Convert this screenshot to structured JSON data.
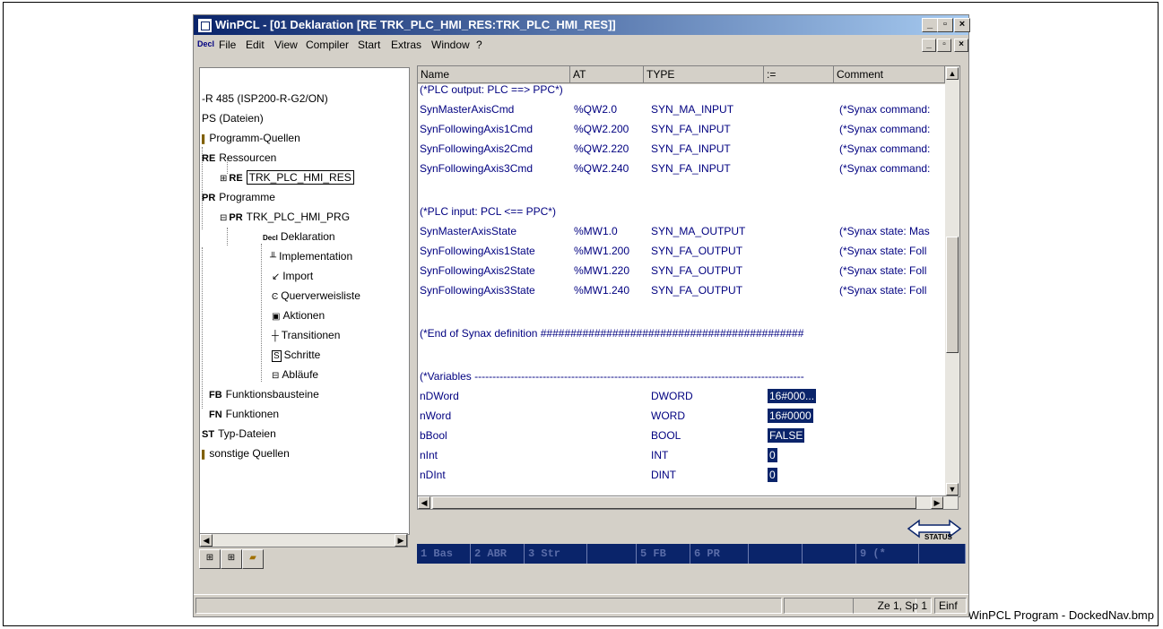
{
  "window": {
    "title": "WinPCL - [01 Deklaration [RE TRK_PLC_HMI_RES:TRK_PLC_HMI_RES]]",
    "btn_min": "_",
    "btn_max": "▫",
    "btn_close": "×"
  },
  "menu": {
    "doc_icon": "Decl",
    "items": [
      "File",
      "Edit",
      "View",
      "Compiler",
      "Start",
      "Extras",
      "Window",
      "?"
    ]
  },
  "tree": {
    "items": [
      {
        "tag": "",
        "label": "-R 485 (ISP200-R-G2/ON)"
      },
      {
        "tag": "",
        "label": "PS (Dateien)"
      },
      {
        "tag": "",
        "label": "Programm-Quellen"
      },
      {
        "tag": "RE",
        "label": "Ressourcen"
      },
      {
        "tag": "RE",
        "label": "TRK_PLC_HMI_RES"
      },
      {
        "tag": "PR",
        "label": "Programme"
      },
      {
        "tag": "PR",
        "label": "TRK_PLC_HMI_PRG"
      },
      {
        "tag": "Decl",
        "label": "Deklaration"
      },
      {
        "tag": "",
        "label": "Implementation"
      },
      {
        "tag": "",
        "label": "Import"
      },
      {
        "tag": "",
        "label": "Querverweisliste"
      },
      {
        "tag": "",
        "label": "Aktionen"
      },
      {
        "tag": "",
        "label": "Transitionen"
      },
      {
        "tag": "",
        "label": "Schritte"
      },
      {
        "tag": "",
        "label": "Abläufe"
      },
      {
        "tag": "FB",
        "label": "Funktionsbausteine"
      },
      {
        "tag": "FN",
        "label": "Funktionen"
      },
      {
        "tag": "ST",
        "label": "Typ-Dateien"
      },
      {
        "tag": "",
        "label": "sonstige Quellen"
      }
    ]
  },
  "editor": {
    "columns": [
      "Name",
      "AT",
      "TYPE",
      ":=",
      "Comment"
    ],
    "lines": [
      {
        "name": "(*PLC output: PLC ==> PPC*)",
        "at": "",
        "type": "",
        "init": "",
        "comment": ""
      },
      {
        "name": "SynMasterAxisCmd",
        "at": "%QW2.0",
        "type": "SYN_MA_INPUT",
        "init": "",
        "comment": "(*Synax command:"
      },
      {
        "name": "SynFollowingAxis1Cmd",
        "at": "%QW2.200",
        "type": "SYN_FA_INPUT",
        "init": "",
        "comment": "(*Synax command:"
      },
      {
        "name": "SynFollowingAxis2Cmd",
        "at": "%QW2.220",
        "type": "SYN_FA_INPUT",
        "init": "",
        "comment": "(*Synax command:"
      },
      {
        "name": "SynFollowingAxis3Cmd",
        "at": "%QW2.240",
        "type": "SYN_FA_INPUT",
        "init": "",
        "comment": "(*Synax command:"
      },
      {
        "name": "(*PLC input: PCL <== PPC*)",
        "at": "",
        "type": "",
        "init": "",
        "comment": ""
      },
      {
        "name": "SynMasterAxisState",
        "at": "%MW1.0",
        "type": "SYN_MA_OUTPUT",
        "init": "",
        "comment": "(*Synax state: Mas"
      },
      {
        "name": "SynFollowingAxis1State",
        "at": "%MW1.200",
        "type": "SYN_FA_OUTPUT",
        "init": "",
        "comment": "(*Synax state: Foll"
      },
      {
        "name": "SynFollowingAxis2State",
        "at": "%MW1.220",
        "type": "SYN_FA_OUTPUT",
        "init": "",
        "comment": "(*Synax state: Foll"
      },
      {
        "name": "SynFollowingAxis3State",
        "at": "%MW1.240",
        "type": "SYN_FA_OUTPUT",
        "init": "",
        "comment": "(*Synax state: Foll"
      },
      {
        "name": "(*End of Synax definition ############################################",
        "at": "",
        "type": "",
        "init": "",
        "comment": ""
      },
      {
        "name": "(*Variables --------------------------------------------------------------------------------------------",
        "at": "",
        "type": "",
        "init": "",
        "comment": ""
      },
      {
        "name": "nDWord",
        "at": "",
        "type": "DWORD",
        "init": "16#000...",
        "comment": ""
      },
      {
        "name": "nWord",
        "at": "",
        "type": "WORD",
        "init": "16#0000",
        "comment": ""
      },
      {
        "name": "bBool",
        "at": "",
        "type": "BOOL",
        "init": "FALSE",
        "comment": ""
      },
      {
        "name": "nInt",
        "at": "",
        "type": "INT",
        "init": "0",
        "comment": ""
      },
      {
        "name": "nDInt",
        "at": "",
        "type": "DINT",
        "init": "0",
        "comment": ""
      }
    ]
  },
  "status_button": "STATUS",
  "tabs": [
    "1 Bas",
    "2 ABR",
    "3 Str",
    "",
    "5 FB",
    "6 PR",
    "",
    "",
    "9 (*",
    ""
  ],
  "statusbar": {
    "position": "Ze 1, Sp 1",
    "mode": "Einf"
  },
  "caption": "WinPCL Program - DockedNav.bmp"
}
